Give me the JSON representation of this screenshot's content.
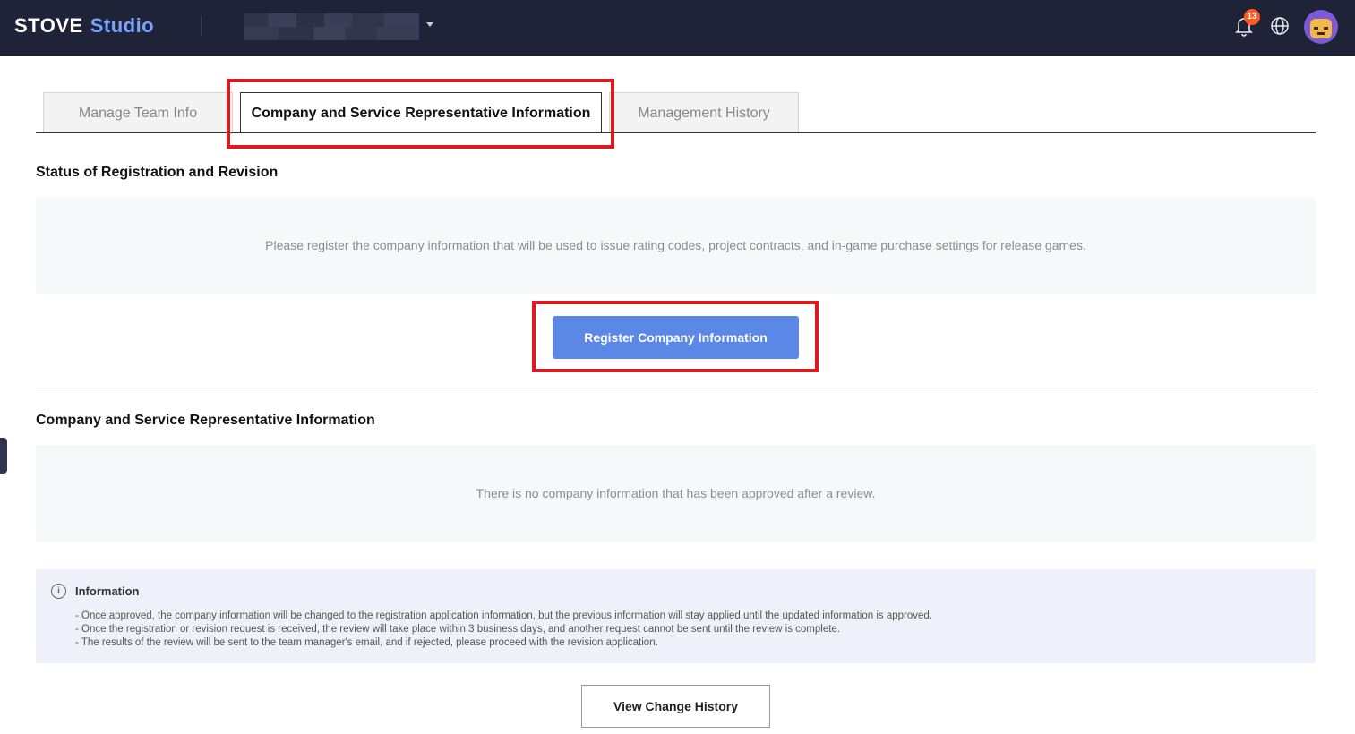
{
  "header": {
    "logo_primary": "STOVE",
    "logo_secondary": "Studio",
    "notification_count": "13",
    "icons": [
      "bell-icon",
      "globe-icon",
      "avatar"
    ]
  },
  "tabs": [
    {
      "label": "Manage Team Info",
      "active": false
    },
    {
      "label": "Company and Service Representative Information",
      "active": true
    },
    {
      "label": "Management History",
      "active": false
    }
  ],
  "registration": {
    "title": "Status of Registration and Revision",
    "message": "Please register the company information that will be used to issue rating codes, project contracts, and in-game purchase settings for release games.",
    "button_label": "Register Company Information"
  },
  "company_info": {
    "title": "Company and Service Representative Information",
    "empty_message": "There is no company information that has been approved after a review."
  },
  "information": {
    "title": "Information",
    "lines": [
      "- Once approved, the company information will be changed to the registration application information, but the previous information will stay applied until the updated information is approved.",
      "- Once the registration or revision request is received, the review will take place within 3 business days, and another request cannot be sent until the review is complete.",
      "- The results of the review will be sent to the team manager's email, and if rejected, please proceed with the revision application."
    ]
  },
  "footer": {
    "history_button": "View Change History"
  },
  "colors": {
    "header_bg": "#1e2337",
    "accent_blue": "#5b87e6",
    "highlight_red": "#e0191f",
    "badge_orange": "#ff5a1f"
  }
}
